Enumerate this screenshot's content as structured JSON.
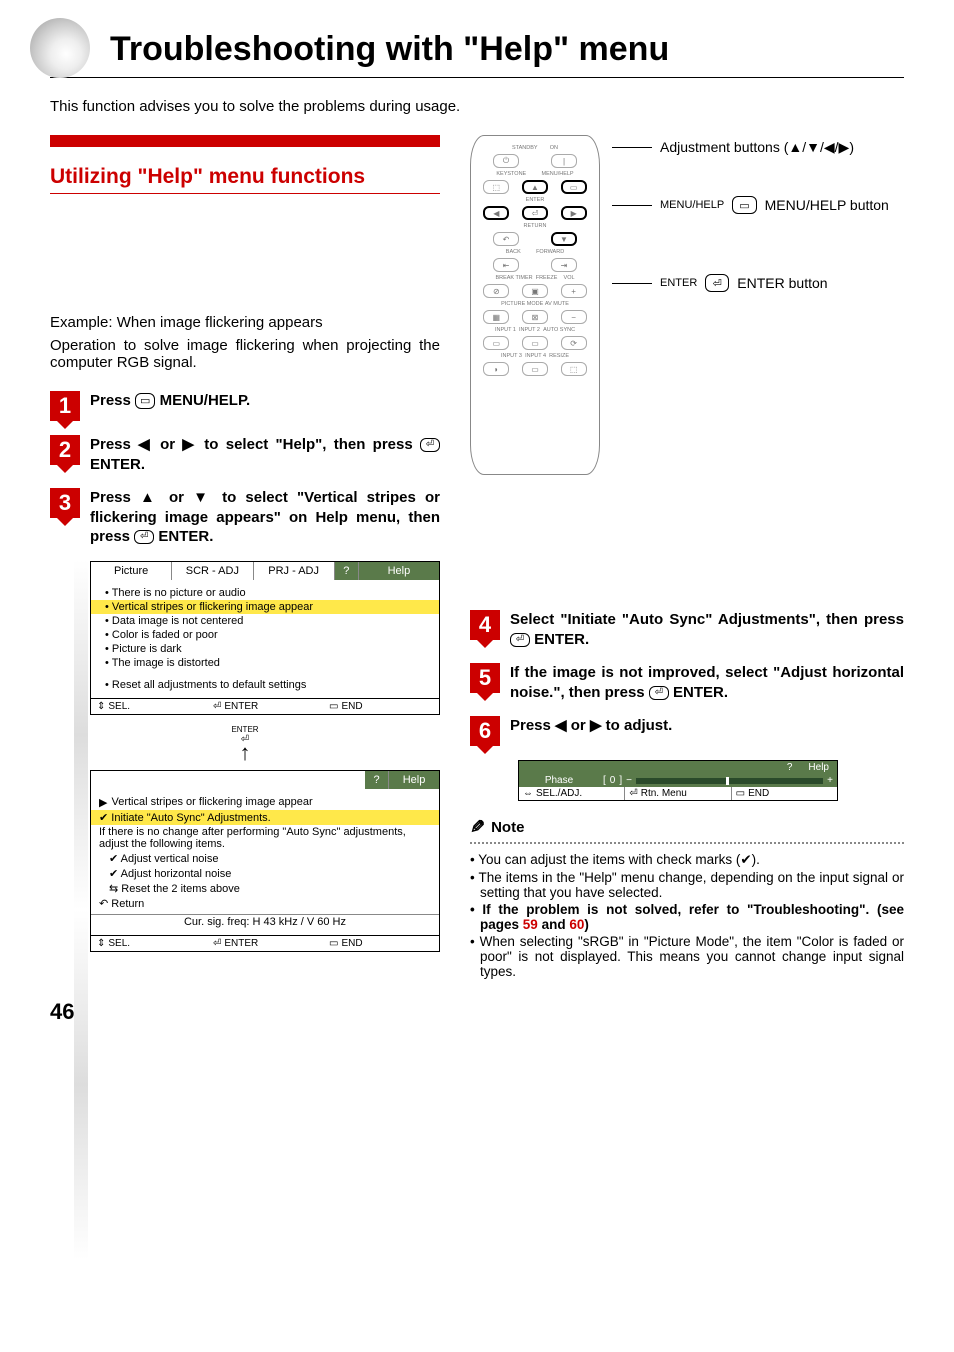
{
  "title": "Troubleshooting with \"Help\" menu",
  "intro": "This function advises you to solve the problems during usage.",
  "section_title": "Utilizing \"Help\" menu functions",
  "example_head": "Example: When image flickering appears",
  "example_body": "Operation to solve image flickering when projecting the computer RGB signal.",
  "steps": {
    "s1": "Press ⊟ MENU/HELP.",
    "s2": "Press ◀ or ▶ to select \"Help\", then press ⏎ ENTER.",
    "s3": "Press ▲ or ▼ to select \"Vertical stripes or flickering image appears\" on Help menu, then press ⏎ ENTER.",
    "s4": "Select \"Initiate \"Auto Sync\" Adjustments\", then press ⏎ ENTER.",
    "s5": "If the image is not improved, select \"Adjust horizontal noise.\", then press ⏎ ENTER.",
    "s6": "Press ◀ or ▶ to adjust."
  },
  "osd1": {
    "tabs": [
      "Picture",
      "SCR - ADJ",
      "PRJ - ADJ",
      "?",
      "Help"
    ],
    "items": [
      "There is no picture or audio",
      "Vertical stripes or flickering image appear",
      "Data image is not centered",
      "Color is faded or poor",
      "Picture is dark",
      "The image is distorted",
      "Reset all adjustments to default settings"
    ],
    "selected": 1,
    "footer": [
      "SEL.",
      "ENTER",
      "END"
    ]
  },
  "osd_arrow_label": "ENTER",
  "osd2": {
    "tabs": [
      "?",
      "Help"
    ],
    "heading": "Vertical stripes or flickering image appear",
    "items": [
      {
        "check": true,
        "text": "Initiate \"Auto Sync\" Adjustments.",
        "sel": true
      },
      {
        "check": false,
        "text": "If there is no change after performing \"Auto Sync\" adjustments, adjust the following items."
      },
      {
        "check": true,
        "text": "Adjust vertical noise",
        "indent": true
      },
      {
        "check": true,
        "text": "Adjust horizontal noise",
        "indent": true
      },
      {
        "check": false,
        "text": "Reset the 2 items above",
        "icon": "reset",
        "indent": true
      },
      {
        "check": false,
        "text": "Return",
        "icon": "return"
      }
    ],
    "sigline": "Cur. sig. freq: H 43 kHz / V 60 Hz",
    "footer": [
      "SEL.",
      "ENTER",
      "END"
    ]
  },
  "remote_labels": {
    "adj": "Adjustment buttons (▲/▼/◀/▶)",
    "menu_key": "MENU/HELP",
    "menu_text": "MENU/HELP button",
    "enter_key": "ENTER",
    "enter_text": "ENTER button"
  },
  "remote_buttons": {
    "standby": "STANDBY",
    "on": "ON",
    "keystone": "KEYSTONE",
    "menuhelp": "MENU/HELP",
    "enter": "ENTER",
    "return": "RETURN",
    "back": "BACK",
    "forward": "FORWARD",
    "breaktimer": "BREAK TIMER",
    "freeze": "FREEZE",
    "vol": "VOL",
    "picmode": "PICTURE MODE",
    "avmute": "AV MUTE",
    "in1": "INPUT 1",
    "in2": "INPUT 2",
    "autosync": "AUTO SYNC",
    "in3": "INPUT 3",
    "in4": "INPUT 4",
    "resize": "RESIZE"
  },
  "phase": {
    "helplabel": "Help",
    "name": "Phase",
    "value": "0",
    "footer": [
      "SEL./ADJ.",
      "Rtn. Menu",
      "END"
    ]
  },
  "note_head": "Note",
  "notes": [
    {
      "text": "You can adjust the items with check marks (✔)."
    },
    {
      "text": "The items in the \"Help\" menu change, depending on the input signal or setting that you have selected."
    },
    {
      "text": "If the problem is not solved, refer to \"Troubleshooting\". (see pages 59 and 60)",
      "bold": true,
      "links": [
        "59",
        "60"
      ]
    },
    {
      "text": "When selecting \"sRGB\" in \"Picture Mode\", the item \"Color is faded or poor\" is not displayed. This means you cannot change input signal types."
    }
  ],
  "page_number": "46"
}
